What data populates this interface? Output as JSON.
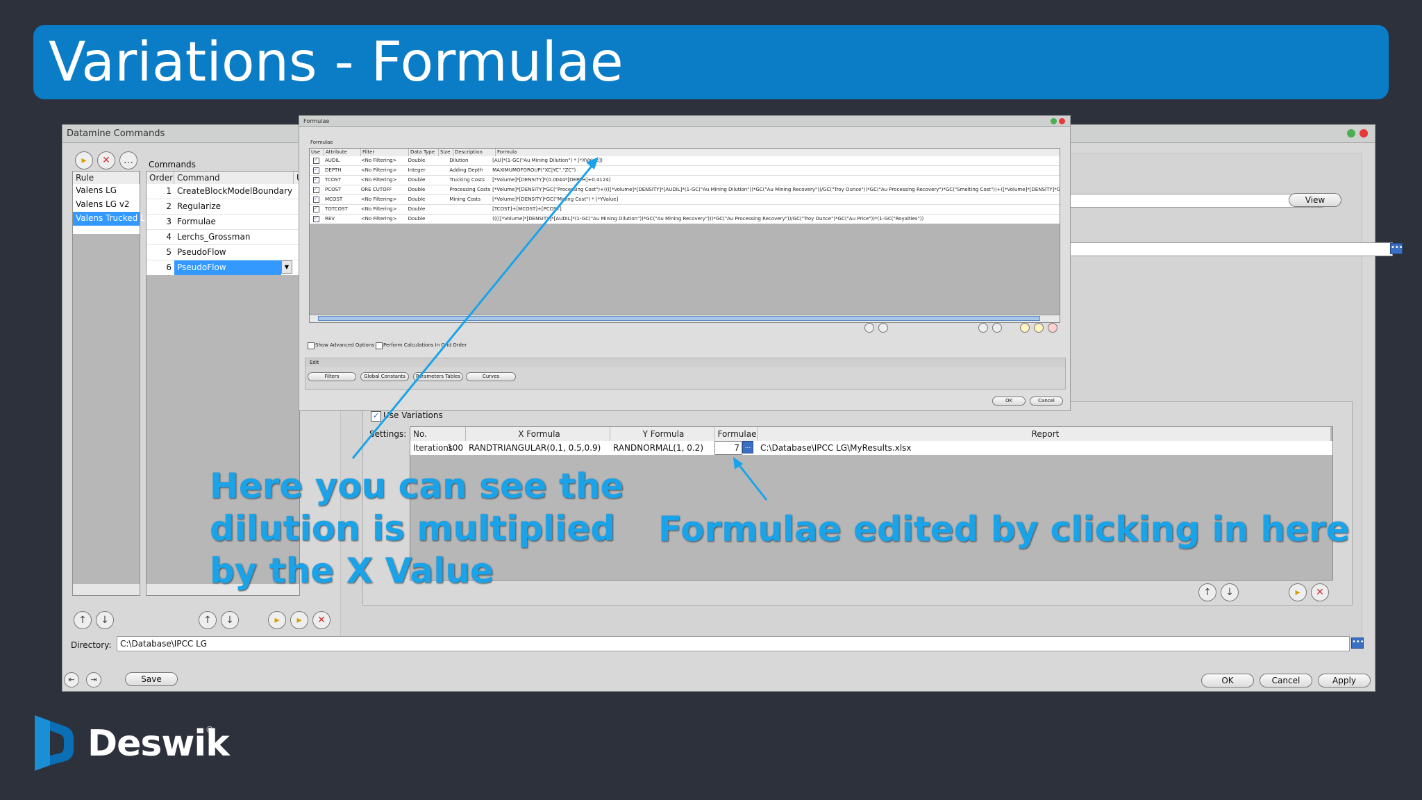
{
  "slide": {
    "title": "Variations - Formulae"
  },
  "main_window": {
    "title": "Datamine Commands",
    "rule_header": "Rule",
    "rules": [
      "Valens LG",
      "Valens LG v2",
      "Valens Trucked L"
    ],
    "commands_label": "Commands",
    "commands_headers": [
      "Order",
      "Command",
      "U"
    ],
    "commands": [
      {
        "order": "1",
        "command": "CreateBlockModelBoundary"
      },
      {
        "order": "2",
        "command": "Regularize"
      },
      {
        "order": "3",
        "command": "Formulae"
      },
      {
        "order": "4",
        "command": "Lerchs_Grossman"
      },
      {
        "order": "5",
        "command": "PseudoFlow"
      },
      {
        "order": "6",
        "command": "PseudoFlow"
      }
    ],
    "view_button": "View",
    "use_variations": "Use Variations",
    "settings_label": "Settings:",
    "var_headers": [
      "No. Iterations",
      "X Formula",
      "Y Formula",
      "Formulae",
      "Report"
    ],
    "var_row": {
      "iterations": "100",
      "x_formula": "RANDTRIANGULAR(0.1, 0.5,0.9)",
      "y_formula": "RANDNORMAL(1, 0.2)",
      "formulae": "7",
      "report": "C:\\Database\\IPCC LG\\MyResults.xlsx"
    },
    "directory_label": "Directory:",
    "directory_value": "C:\\Database\\IPCC LG",
    "save_button": "Save",
    "ok_button": "OK",
    "cancel_button": "Cancel",
    "apply_button": "Apply"
  },
  "formulae_dialog": {
    "title": "Formulae",
    "group_label": "Formulae",
    "headers": [
      "Use",
      "Attribute",
      "Filter",
      "Data Type",
      "Size",
      "Description",
      "Formula"
    ],
    "rows": [
      {
        "attr": "AUDIL",
        "filter": "<No Filtering>",
        "type": "Double",
        "desc": "Dilution",
        "formula": "[AU]*(1-GC(\"Au Mining Dilution\") * [*XValue])"
      },
      {
        "attr": "DEPTH",
        "filter": "<No Filtering>",
        "type": "Integer",
        "desc": "Adding Depth",
        "formula": "MAXIMUMOFGROUP(\"XC|YC\",\"ZC\")"
      },
      {
        "attr": "TCOST",
        "filter": "<No Filtering>",
        "type": "Double",
        "desc": "Trucking Costs",
        "formula": "[*Volume]*[DENSITY]*(0.0044*[DEPTH]+0.4124)"
      },
      {
        "attr": "PCOST",
        "filter": "ORE CUTOFF",
        "type": "Double",
        "desc": "Processing Costs",
        "formula": "[*Volume]*[DENSITY]*GC(\"Processing Cost\")+((([*Volume]*[DENSITY]*[AUDIL]*(1-GC(\"Au Mining Dilution\"))*GC(\"Au Mining Recovery\"))/GC(\"Troy Ounce\"))*GC(\"Au Processing Recovery\")*GC(\"Smelting Cost\"))+([*Volume]*[DENSITY]*GC(\"G &"
      },
      {
        "attr": "MCOST",
        "filter": "<No Filtering>",
        "type": "Double",
        "desc": "Mining Costs",
        "formula": "[*Volume]*[DENSITY]*GC(\"Mining Cost\") * [*YValue]"
      },
      {
        "attr": "TOTCOST",
        "filter": "<No Filtering>",
        "type": "Double",
        "desc": "",
        "formula": "[TCOST]+[MCOST]+[PCOST]"
      },
      {
        "attr": "REV",
        "filter": "<No Filtering>",
        "type": "Double",
        "desc": "",
        "formula": "(((([*Volume]*[DENSITY]*[AUDIL]*(1-GC(\"Au Mining Dilution\"))*GC(\"Au Mining Recovery\")))*GC(\"Au Processing Recovery\"))/GC(\"Troy Ounce\")*GC(\"Au Price\"))*(1-GC(\"Royalties\"))"
      }
    ],
    "show_advanced": "Show Advanced Options",
    "perform_calc": "Perform Calculations In Grid Order",
    "edit_label": "Edit",
    "edit_buttons": [
      "Filters",
      "Global Constants",
      "Parameters Tables",
      "Curves"
    ],
    "ok_button": "OK",
    "cancel_button": "Cancel"
  },
  "callouts": {
    "left": [
      "Here you can see the",
      "dilution is multiplied",
      "by the X Value"
    ],
    "right": "Formulae edited by clicking in here"
  },
  "logo": {
    "text": "Deswik",
    "mark": "®"
  },
  "colors": {
    "accent": "#0a7dc6",
    "callout": "#1aa3e8",
    "background": "#2c313c",
    "selection": "#3399ff"
  }
}
